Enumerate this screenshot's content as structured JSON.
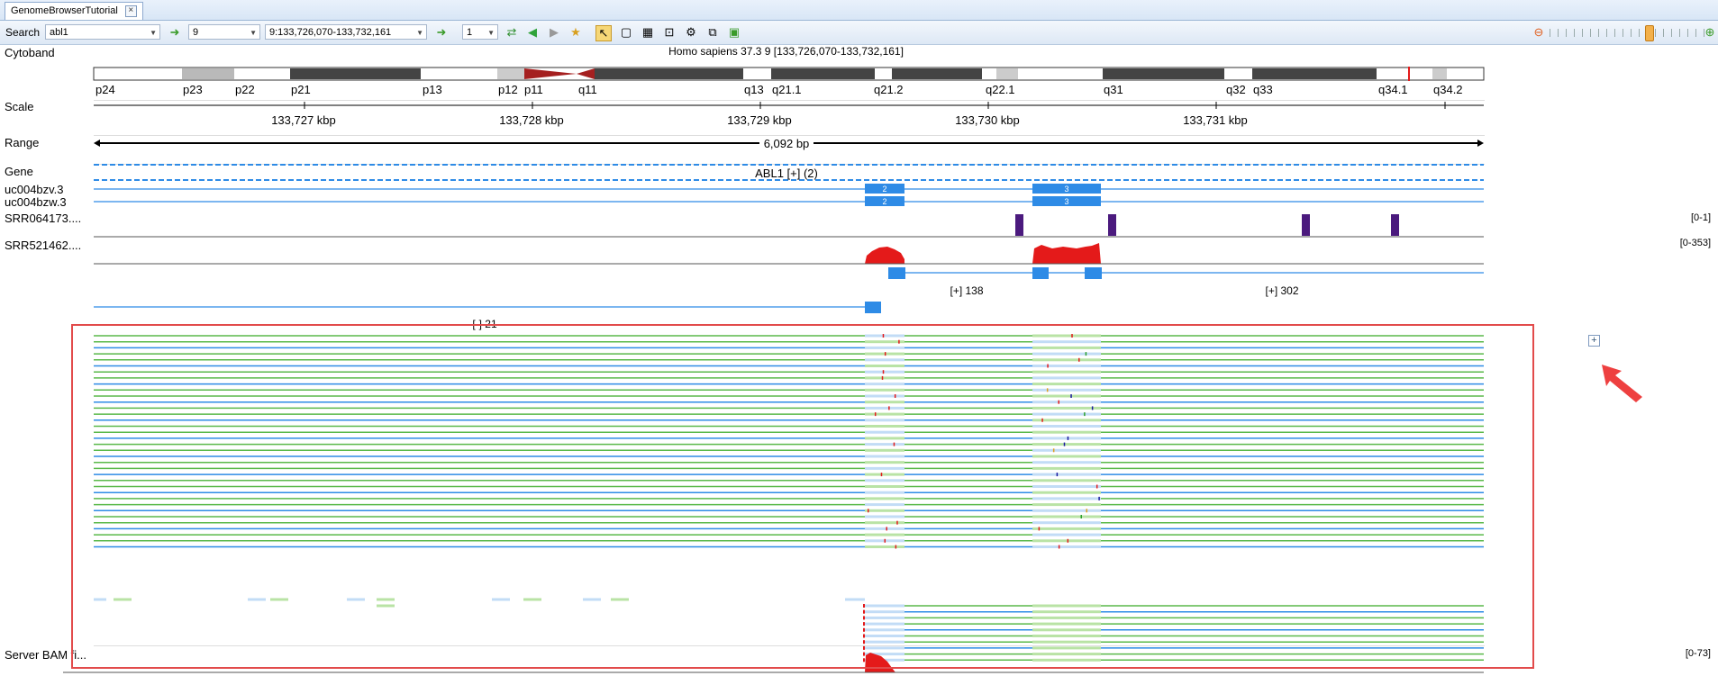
{
  "tab": {
    "title": "GenomeBrowserTutorial"
  },
  "toolbar": {
    "search_label": "Search",
    "search_value": "abl1",
    "chromosome": "9",
    "locus": "9:133,726,070-133,732,161",
    "page": "1"
  },
  "header": {
    "assembly": "Homo sapiens 37.3 9 [133,726,070-133,732,161]"
  },
  "tracks": {
    "cytoband": "Cytoband",
    "scale": "Scale",
    "range": "Range",
    "gene": "Gene",
    "tx1": "uc004bzv.3",
    "tx2": "uc004bzw.3",
    "srr1": "SRR064173....",
    "srr2": "SRR521462....",
    "bam": "Server BAM fi..."
  },
  "ranges": {
    "srr1": "[0-1]",
    "srr2": "[0-353]",
    "bam": "[0-73]"
  },
  "cytobands": [
    "p24",
    "p23",
    "p22",
    "p21",
    "p13",
    "p12",
    "p11",
    "q11",
    "q13",
    "q21.1",
    "q21.2",
    "q22.1",
    "q31",
    "q32",
    "q33",
    "q34.1",
    "q34.2"
  ],
  "scale_ticks": [
    "133,727 kbp",
    "133,728 kbp",
    "133,729 kbp",
    "133,730 kbp",
    "133,731 kbp"
  ],
  "range_text": "6,092 bp",
  "gene_label": "ABL1 [+] (2)",
  "exon_labels": [
    "2",
    "3"
  ],
  "groups": {
    "g1": "[+] 138",
    "g2": "[+] 302",
    "g3": "[-] 21"
  },
  "colors": {
    "blue": "#2e8be6",
    "green": "#5ab94a",
    "red": "#e41a1a",
    "purple": "#4b1a7e",
    "highlight": "#e24b4b"
  }
}
